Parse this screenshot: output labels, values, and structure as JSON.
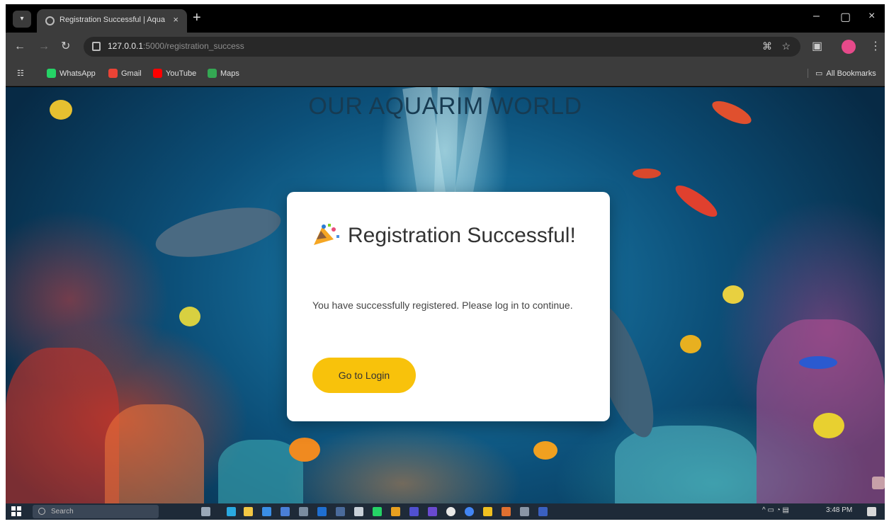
{
  "browser": {
    "tab_title": "Registration Successful | Aqua",
    "tab_close": "×",
    "new_tab": "+",
    "window_controls": {
      "minimize": "–",
      "maximize": "▢",
      "close": "×"
    },
    "url_host": "127.0.0.1",
    "url_path": ":5000/registration_success",
    "bookmarks": [
      {
        "label": "WhatsApp",
        "color": "#25d366"
      },
      {
        "label": "Gmail",
        "color": "#ea4335"
      },
      {
        "label": "YouTube",
        "color": "#ff0000"
      },
      {
        "label": "Maps",
        "color": "#34a853"
      }
    ],
    "all_bookmarks": "All Bookmarks"
  },
  "page": {
    "site_title": "OUR AQUARIM WORLD",
    "card": {
      "heading": "Registration Successful!",
      "message": "You have successfully registered. Please log in to continue.",
      "button_label": "Go to Login"
    },
    "colors": {
      "button": "#f8c20b",
      "title": "#173b52"
    }
  },
  "taskbar": {
    "search_placeholder": "Search",
    "time": "3:48 PM"
  }
}
